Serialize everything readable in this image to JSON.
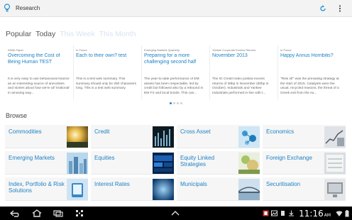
{
  "app": {
    "title": "Research"
  },
  "period_tabs": [
    {
      "label": "Popular",
      "state": "active"
    },
    {
      "label": "Today",
      "state": "active"
    },
    {
      "label": "This Week",
      "state": "inactive"
    },
    {
      "label": "This Month",
      "state": "inactive"
    }
  ],
  "cards": [
    {
      "category": "White Paper",
      "title": "Overcoming the Cost of Being Human TEST",
      "summary": "It is very easy to use behavioural finance as an interesting source of anecdotes and stories about how we're all 'irrational' in amusing way..."
    },
    {
      "category": "In Focus",
      "title": "Each to their own? test",
      "summary": "This is a test web summary. This summary should only be 250 characters long. This is a test web summary."
    },
    {
      "category": "Emerging Markets Quarterly",
      "title": "Preparing for a more challenging second half",
      "summary": "The year-to-date performance of EM assets has been respectable, led by credit but followed also by a rebound in EM FX and local bonds. This can..."
    },
    {
      "category": "Yankee Corporate Excess Returns",
      "title": "November 2013",
      "summary": "The IG Credit Index posted excess returns of 38bp in November (80bp in October). Industrials and Yankee Industrials performed in line with t..."
    },
    {
      "category": "In Focus",
      "title": "Happy Annus Horribilis?",
      "summary": "\"Risk off\" was the prevailing strategy at the start of 2015. Catalysts were the usual, recycled reasons, the threat of a Greek exit from the eu..."
    }
  ],
  "pager": {
    "count": 4,
    "active_index": 0
  },
  "browse": {
    "title": "Browse",
    "tiles": [
      {
        "label": "Commodities",
        "thumb": "gold-sun"
      },
      {
        "label": "Credit",
        "thumb": "dark-chart"
      },
      {
        "label": "Cross Asset",
        "thumb": "blue-network"
      },
      {
        "label": "Economics",
        "thumb": "grey-chart"
      },
      {
        "label": "Emerging Markets",
        "thumb": "blue-city"
      },
      {
        "label": "Equities",
        "thumb": "blue-ticker"
      },
      {
        "label": "Equity Linked Strategies",
        "thumb": "green-growth"
      },
      {
        "label": "Foreign Exchange",
        "thumb": "fx-board"
      },
      {
        "label": "Index, Portfolio & Risk Solutions",
        "thumb": "hands-device"
      },
      {
        "label": "Interest Rates",
        "thumb": "blue-wave"
      },
      {
        "label": "Municipals",
        "thumb": "bridge"
      },
      {
        "label": "Securitisation",
        "thumb": "grey-screen"
      }
    ]
  },
  "status_bar": {
    "time": "11:16",
    "am_pm": "AM"
  },
  "colors": {
    "link": "#1d82c4",
    "tab_inactive": "#d8e3f0",
    "action_bar": "#f3f3f3"
  }
}
